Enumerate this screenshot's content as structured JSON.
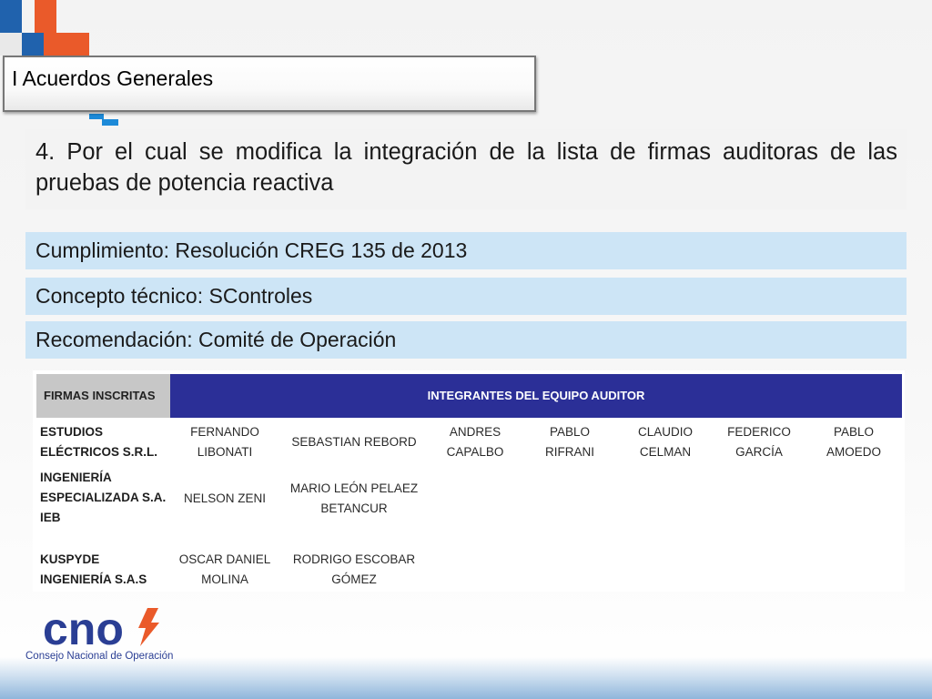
{
  "section_title": "I Acuerdos Generales",
  "heading": "4. Por el cual se modifica la integración de la lista de firmas auditoras de las pruebas de potencia reactiva",
  "info": {
    "cumplimiento": "Cumplimiento: Resolución CREG 135 de 2013",
    "concepto": "Concepto técnico: SControles",
    "recomendacion": "Recomendación: Comité de Operación"
  },
  "table": {
    "header_left": "FIRMAS INSCRITAS",
    "header_right": "INTEGRANTES DEL EQUIPO AUDITOR",
    "rows": [
      {
        "firm": "ESTUDIOS\nELÉCTRICOS S.R.L.",
        "members": [
          "FERNANDO\nLIBONATI",
          "SEBASTIAN REBORD",
          "ANDRES\nCAPALBO",
          "PABLO\nRIFRANI",
          "CLAUDIO\nCELMAN",
          "FEDERICO\nGARCÍA",
          "PABLO\nAMOEDO"
        ]
      },
      {
        "firm": "INGENIERÍA\nESPECIALIZADA S.A.\nIEB",
        "members": [
          "NELSON ZENI",
          "MARIO LEÓN PELAEZ\nBETANCUR"
        ]
      },
      {
        "firm": "KUSPYDE\nINGENIERÍA S.A.S",
        "members": [
          "OSCAR DANIEL\nMOLINA",
          "RODRIGO ESCOBAR\nGÓMEZ"
        ]
      }
    ]
  },
  "logo": {
    "text": "cno",
    "subtitle": "Consejo Nacional de Operación",
    "icon": "lightning-bolt-icon",
    "brand_color": "#2a3e94",
    "accent_color": "#ea5a2a"
  },
  "colors": {
    "info_bar_bg": "#cde5f6",
    "table_header_blue": "#2b2f97",
    "table_header_gray": "#c7c7c7"
  }
}
